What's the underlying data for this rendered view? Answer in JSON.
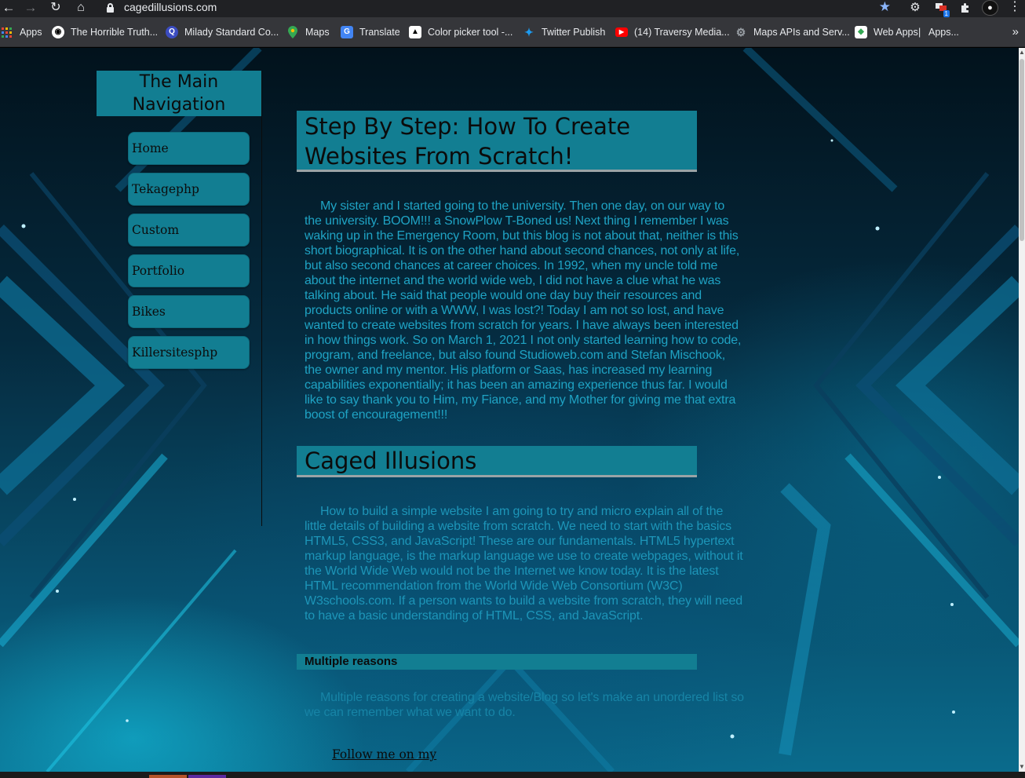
{
  "browser": {
    "url": "cagedillusions.com",
    "ext_badge": "1",
    "bookmarks": [
      {
        "label": "Apps",
        "icon": "apps-grid-icon"
      },
      {
        "label": "The Horrible Truth...",
        "icon": "github-icon"
      },
      {
        "label": "Milady Standard Co...",
        "icon": "q-logo-icon"
      },
      {
        "label": "Maps",
        "icon": "maps-pin-icon"
      },
      {
        "label": "Translate",
        "icon": "translate-icon"
      },
      {
        "label": "Color picker tool -...",
        "icon": "color-picker-icon"
      },
      {
        "label": "Twitter Publish",
        "icon": "twitter-icon"
      },
      {
        "label": "(14) Traversy Media...",
        "icon": "youtube-icon"
      },
      {
        "label": "Maps APIs and Serv...",
        "icon": "api-gear-icon"
      },
      {
        "label": "Web Apps",
        "icon": "web-apps-icon"
      },
      {
        "label": "Apps...",
        "icon": ""
      }
    ],
    "overflow": "»"
  },
  "sidebar": {
    "title": "The Main Navigation",
    "items": [
      {
        "label": "Home"
      },
      {
        "label": "Tekagephp"
      },
      {
        "label": "Custom"
      },
      {
        "label": "Portfolio"
      },
      {
        "label": "Bikes"
      },
      {
        "label": "Killersitesphp"
      }
    ]
  },
  "main": {
    "heading1": "Step By Step: How To Create Websites From Scratch!",
    "paragraph1": "My sister and I started going to the university. Then one day, on our way to the university. BOOM!!! a SnowPlow T-Boned us! Next thing I remember I was waking up in the Emergency Room, but this blog is not about that, neither is this short biographical. It is on the other hand about second chances, not only at life, but also second chances at career choices. In 1992, when my uncle told me about the internet and the world wide web, I did not have a clue what he was talking about. He said that people would one day buy their resources and products online or with a WWW, I was lost?! Today I am not so lost, and have wanted to create websites from scratch for years. I have always been interested in how things work. So on March 1, 2021 I not only started learning how to code, program, and freelance, but also found Studioweb.com and Stefan Mischook, the owner and my mentor. His platform or Saas, has increased my learning capabilities exponentially; it has been an amazing experience thus far. I would like to say thank you to Him, my Fiance, and my Mother for giving me that extra boost of encouragement!!!",
    "heading2": "Caged Illusions",
    "paragraph2": "How to build a simple website I am going to try and micro explain all of the little details of building a website from scratch. We need to start with the basics HTML5, CSS3, and JavaScript! These are our fundamentals. HTML5 hypertext markup language, is the markup language we use to create webpages, without it the World Wide Web would not be the Internet we know today. It is the latest HTML recommendation from the World Wide Web Consortium (W3C) W3schools.com. If a person wants to build a website from scratch, they will need to have a basic understanding of HTML, CSS, and JavaScript.",
    "heading3": "Multiple reasons",
    "paragraph3": "Multiple reasons for creating a website/Blog so let's make an unordered list so we can remember what we want to do.",
    "follow_link": "Follow me on my"
  },
  "colors": {
    "accent": "#127e92",
    "text_light": "#1fa3c4",
    "background_dark": "#02121c"
  }
}
